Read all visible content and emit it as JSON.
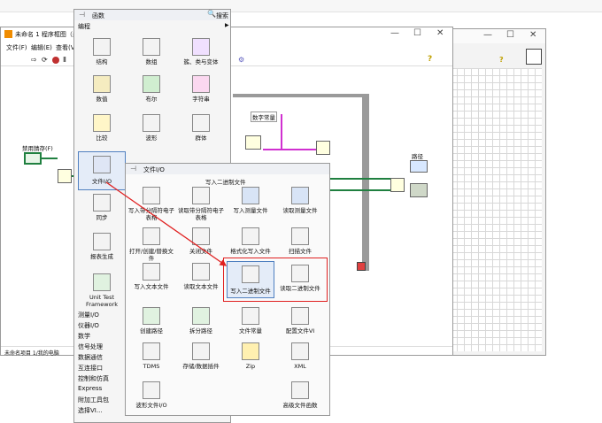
{
  "bd_window": {
    "title": "未命名 1 程序框图（未",
    "menu": [
      "文件(F)",
      "编辑(E)",
      "查看(V)"
    ],
    "left_label": "禁用猜存(F)",
    "status": "未命名项目 1/我的电脑",
    "constant_label": "数字常量",
    "path_label": "路径"
  },
  "functions_palette": {
    "title": "函数",
    "search_label": "搜索",
    "subtitle": "编程",
    "cells": [
      {
        "label": "结构"
      },
      {
        "label": "数组"
      },
      {
        "label": "簇、类与变体"
      },
      {
        "label": "数值"
      },
      {
        "label": "布尔"
      },
      {
        "label": "字符串"
      },
      {
        "label": "比较"
      },
      {
        "label": "波形"
      },
      {
        "label": "群体"
      },
      {
        "label": "文件I/O"
      }
    ],
    "left_cells": [
      "同步",
      "报表生成",
      "Unit Test Framework"
    ],
    "categories": [
      "测量I/O",
      "仪器I/O",
      "数学",
      "信号处理",
      "数据通信",
      "互连接口",
      "控制和仿真",
      "Express",
      "附加工具包",
      "选择VI..."
    ]
  },
  "file_io_palette": {
    "title": "文件I/O",
    "tooltip": "写入二进制文件",
    "items": [
      {
        "label": "写入带分隔符电子表格"
      },
      {
        "label": "读取带分隔符电子表格"
      },
      {
        "label": "写入测量文件"
      },
      {
        "label": "读取测量文件"
      },
      {
        "label": "打开/创建/替换文件"
      },
      {
        "label": "关闭文件"
      },
      {
        "label": "格式化写入文件"
      },
      {
        "label": "扫描文件"
      },
      {
        "label": "写入文本文件"
      },
      {
        "label": "读取文本文件"
      },
      {
        "label": "写入二进制文件"
      },
      {
        "label": "读取二进制文件"
      },
      {
        "label": "创建路径"
      },
      {
        "label": "拆分路径"
      },
      {
        "label": "文件常量"
      },
      {
        "label": "配置文件VI"
      },
      {
        "label": "TDMS"
      },
      {
        "label": "存储/数据插件"
      },
      {
        "label": "Zip"
      },
      {
        "label": "XML"
      },
      {
        "label": "波形文件I/O"
      },
      {
        "label": "高级文件函数"
      }
    ]
  },
  "colors": {
    "highlight": "#e02020",
    "accent": "#2060c0",
    "wire_pink": "#d030d0",
    "wire_green": "#208040"
  }
}
